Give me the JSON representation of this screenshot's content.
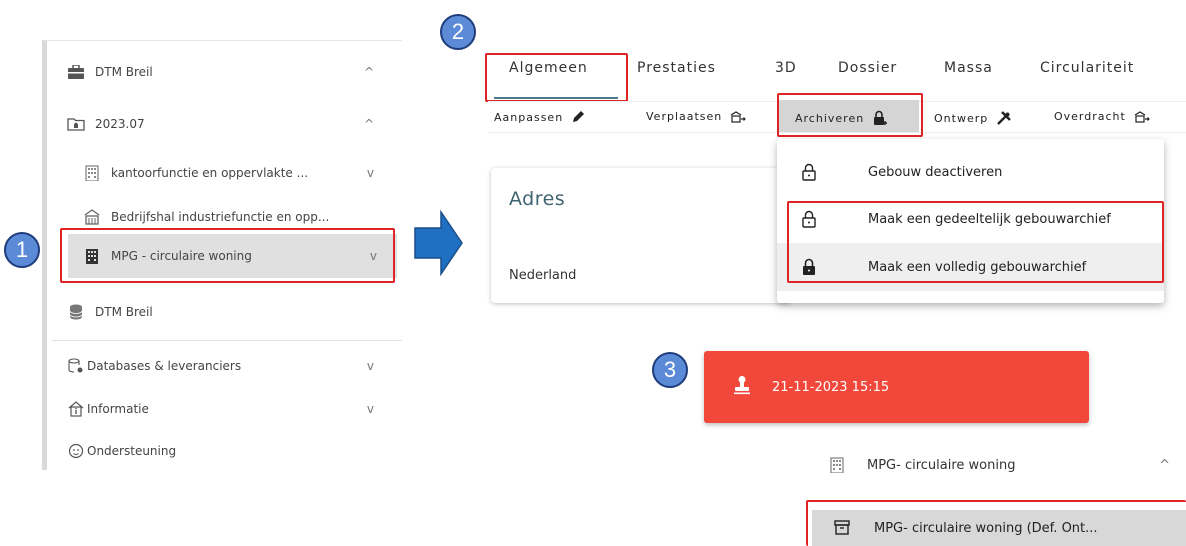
{
  "callouts": [
    "1",
    "2",
    "3"
  ],
  "sidebar": {
    "items": [
      {
        "label": "DTM Breil",
        "icon": "briefcase-icon",
        "chevron": "^"
      },
      {
        "label": "2023.07",
        "icon": "folder-building-icon",
        "chevron": "^"
      },
      {
        "label": "kantoorfunctie en oppervlakte ...",
        "icon": "office-building-icon",
        "chevron": "v"
      },
      {
        "label": "Bedrijfshal industriefunctie en opp...",
        "icon": "warehouse-icon",
        "chevron": ""
      },
      {
        "label": "MPG - circulaire woning",
        "icon": "office-building-icon",
        "chevron": "v"
      },
      {
        "label": "DTM Breil",
        "icon": "database-icon",
        "chevron": ""
      },
      {
        "label": "Databases & leveranciers",
        "icon": "database-settings-icon",
        "chevron": "v"
      },
      {
        "label": "Informatie",
        "icon": "house-info-icon",
        "chevron": "v"
      },
      {
        "label": "Ondersteuning",
        "icon": "support-face-icon",
        "chevron": ""
      }
    ]
  },
  "tabs": [
    "Algemeen",
    "Prestaties",
    "3D",
    "Dossier",
    "Massa",
    "Circulariteit"
  ],
  "actions": [
    "Aanpassen",
    "Verplaatsen",
    "Archiveren",
    "Ontwerp",
    "Overdracht"
  ],
  "card": {
    "title": "Adres",
    "country": "Nederland"
  },
  "dropdown": [
    "Gebouw deactiveren",
    "Maak een gedeeltelijk gebouwarchief",
    "Maak een volledig gebouwarchief"
  ],
  "toast": {
    "timestamp": "21-11-2023 15:15",
    "color": "#f2473b"
  },
  "tree": {
    "item_label": "MPG- circulaire woning",
    "item_chevron": "^",
    "archive_label": "MPG- circulaire woning (Def. Ont..."
  },
  "colors": {
    "highlight": "#e02424",
    "callout": "#5b8bd6",
    "arrow": "#1f6fc2",
    "accent": "#4a7a8c"
  }
}
